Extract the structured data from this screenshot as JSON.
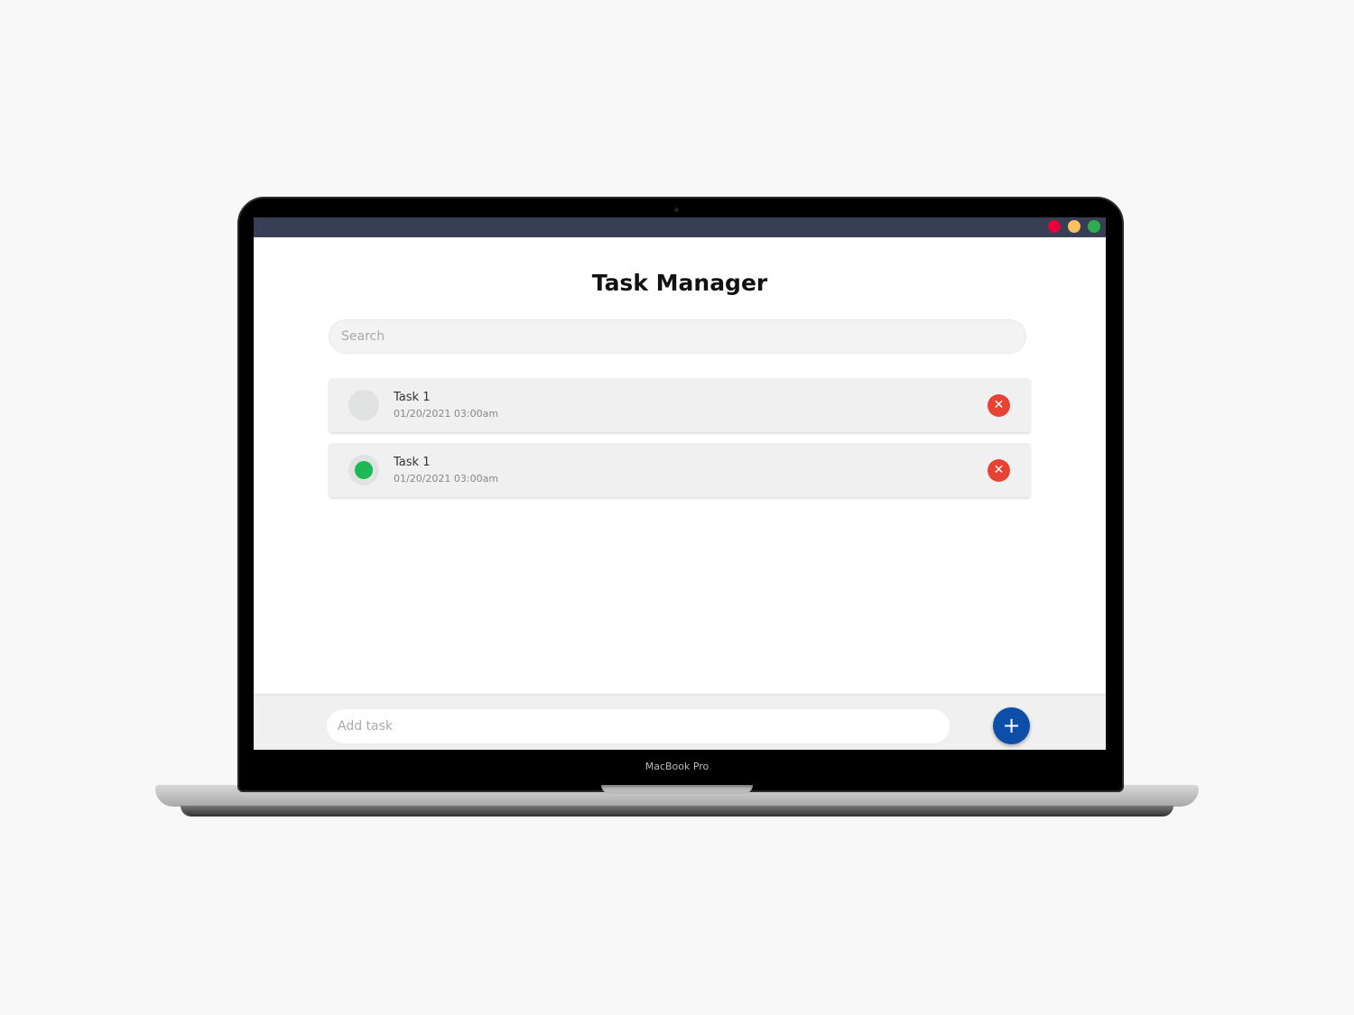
{
  "window": {
    "dots": {
      "close": "#e5003e",
      "minimize": "#fdc05c",
      "maximize": "#2fad4e"
    }
  },
  "app": {
    "title": "Task Manager"
  },
  "search": {
    "placeholder": "Search"
  },
  "tasks": [
    {
      "name": "Task 1",
      "date": "01/20/2021 03:00am",
      "completed": false
    },
    {
      "name": "Task 1",
      "date": "01/20/2021 03:00am",
      "completed": true
    }
  ],
  "icons": {
    "delete": "close-x-icon",
    "add": "plus-icon"
  },
  "delete_glyph": "✕",
  "add_task": {
    "placeholder": "Add task",
    "button_glyph": "+"
  },
  "colors": {
    "accent": "#0d4fa8",
    "danger": "#e74335",
    "success": "#1db954",
    "titlebar": "#363f55"
  },
  "device": {
    "label": "MacBook Pro"
  }
}
